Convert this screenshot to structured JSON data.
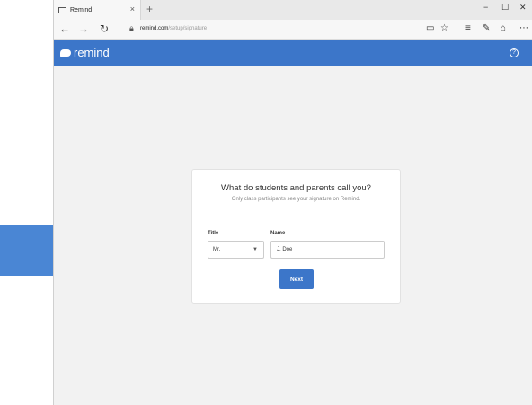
{
  "browser": {
    "tab_title": "Remind",
    "tab_close": "×",
    "new_tab": "+",
    "url_domain": "remind.com",
    "url_path": "/setup/signature",
    "window_minimize": "−",
    "window_maximize": "☐",
    "window_close": "✕"
  },
  "app": {
    "logo_text": "remind",
    "help_label": "?"
  },
  "card": {
    "title": "What do students and parents call you?",
    "subtitle": "Only class participants see your signature on Remind.",
    "title_label": "Title",
    "title_value": "Mr.",
    "name_label": "Name",
    "name_value": "J. Doe",
    "next_label": "Next"
  },
  "colors": {
    "brand": "#3c76c9",
    "arrow": "#4a86d4"
  }
}
